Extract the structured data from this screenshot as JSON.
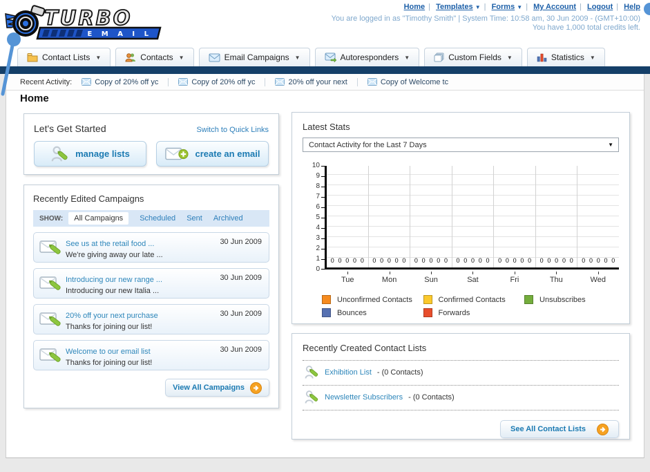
{
  "header": {
    "logo_title": "TURBO",
    "logo_subtitle": "E M A I L",
    "links": [
      {
        "label": "Home",
        "dropdown": false
      },
      {
        "label": "Templates",
        "dropdown": true
      },
      {
        "label": "Forms",
        "dropdown": true
      },
      {
        "label": "My Account",
        "dropdown": false
      },
      {
        "label": "Logout",
        "dropdown": false
      },
      {
        "label": "Help",
        "dropdown": false
      }
    ],
    "login_info": "You are logged in as \"Timothy Smith\" | System Time: 10:58 am, 30 Jun 2009 - (GMT+10:00)",
    "credits_info": "You have 1,000 total credits left."
  },
  "nav": {
    "tabs": [
      {
        "label": "Contact Lists"
      },
      {
        "label": "Contacts"
      },
      {
        "label": "Email Campaigns"
      },
      {
        "label": "Autoresponders"
      },
      {
        "label": "Custom Fields"
      },
      {
        "label": "Statistics"
      }
    ]
  },
  "recent_activity": {
    "label": "Recent Activity:",
    "items": [
      "Copy of 20% off yc",
      "Copy of 20% off yc",
      "20% off your next",
      "Copy of Welcome tc"
    ]
  },
  "page_title": "Home",
  "get_started": {
    "title": "Let's Get Started",
    "switch_link": "Switch to Quick Links",
    "buttons": [
      {
        "label": "manage lists"
      },
      {
        "label": "create an email"
      }
    ]
  },
  "campaigns": {
    "title": "Recently Edited Campaigns",
    "show_label": "SHOW:",
    "filters": [
      "All Campaigns",
      "Scheduled",
      "Sent",
      "Archived"
    ],
    "active_filter": "All Campaigns",
    "items": [
      {
        "title": "See us at the retail food ...",
        "subtitle": "We're giving away our late ...",
        "date": "30 Jun 2009"
      },
      {
        "title": "Introducing our new range ...",
        "subtitle": "Introducing our new Italia ...",
        "date": "30 Jun 2009"
      },
      {
        "title": "20% off your next purchase",
        "subtitle": "Thanks for joining our list!",
        "date": "30 Jun 2009"
      },
      {
        "title": "Welcome to our email list",
        "subtitle": "Thanks for joining our list!",
        "date": "30 Jun 2009"
      }
    ],
    "view_all_label": "View All Campaigns"
  },
  "latest_stats": {
    "title": "Latest Stats",
    "selected_option": "Contact Activity for the Last 7 Days"
  },
  "chart_data": {
    "type": "bar",
    "title": "Contact Activity for the Last 7 Days",
    "categories": [
      "Tue",
      "Mon",
      "Sun",
      "Sat",
      "Fri",
      "Thu",
      "Wed"
    ],
    "series": [
      {
        "name": "Unconfirmed Contacts",
        "color": "#f68b1f",
        "values": [
          0,
          0,
          0,
          0,
          0,
          0,
          0
        ]
      },
      {
        "name": "Confirmed Contacts",
        "color": "#fbc92d",
        "values": [
          0,
          0,
          0,
          0,
          0,
          0,
          0
        ]
      },
      {
        "name": "Unsubscribes",
        "color": "#74ad3c",
        "values": [
          0,
          0,
          0,
          0,
          0,
          0,
          0
        ]
      },
      {
        "name": "Bounces",
        "color": "#5671b2",
        "values": [
          0,
          0,
          0,
          0,
          0,
          0,
          0
        ]
      },
      {
        "name": "Forwards",
        "color": "#e84e2c",
        "values": [
          0,
          0,
          0,
          0,
          0,
          0,
          0
        ]
      }
    ],
    "ylim": [
      0,
      10
    ],
    "ytick_step": 1,
    "grid": true,
    "value_labels_shown": true,
    "legend_position": "bottom"
  },
  "contact_lists": {
    "title": "Recently Created Contact Lists",
    "items": [
      {
        "name": "Exhibition List",
        "count": "- (0 Contacts)"
      },
      {
        "name": "Newsletter Subscribers",
        "count": "- (0 Contacts)"
      }
    ],
    "see_all_label": "See All Contact Lists"
  }
}
